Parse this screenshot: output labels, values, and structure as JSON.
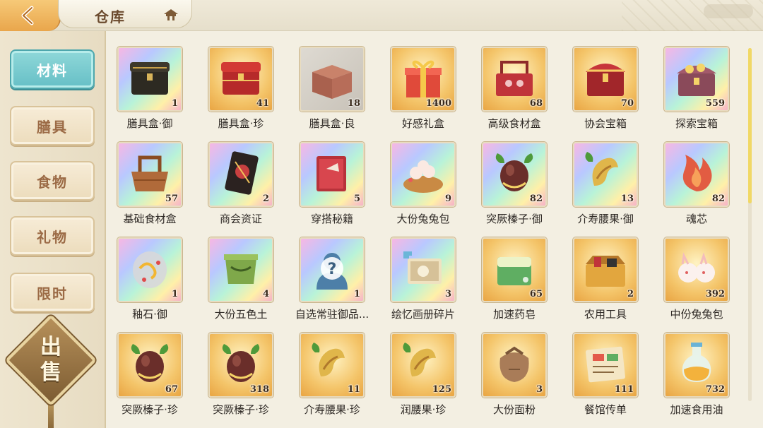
{
  "header": {
    "title": "仓库"
  },
  "sidebar": {
    "tabs": [
      {
        "label": "材料",
        "active": true
      },
      {
        "label": "膳具",
        "active": false
      },
      {
        "label": "食物",
        "active": false
      },
      {
        "label": "礼物",
        "active": false
      },
      {
        "label": "限时",
        "active": false
      }
    ],
    "sell_label": "出售"
  },
  "items": [
    {
      "name": "膳具盒·御",
      "count": "1",
      "bg": "rainbow",
      "icon": "black-chest-icon"
    },
    {
      "name": "膳具盒·珍",
      "count": "41",
      "bg": "gold",
      "icon": "red-chest-icon"
    },
    {
      "name": "膳具盒·良",
      "count": "18",
      "bg": "gray",
      "icon": "plain-box-icon"
    },
    {
      "name": "好感礼盒",
      "count": "1400",
      "bg": "gold",
      "icon": "gift-box-icon"
    },
    {
      "name": "高级食材盒",
      "count": "68",
      "bg": "gold",
      "icon": "food-basket-icon"
    },
    {
      "name": "协会宝箱",
      "count": "70",
      "bg": "gold",
      "icon": "treasure-chest-icon"
    },
    {
      "name": "探索宝箱",
      "count": "559",
      "bg": "rainbow",
      "icon": "explore-chest-icon"
    },
    {
      "name": "基础食材盒",
      "count": "57",
      "bg": "rainbow",
      "icon": "wooden-basket-icon"
    },
    {
      "name": "商会资证",
      "count": "2",
      "bg": "rainbow",
      "icon": "card-icon"
    },
    {
      "name": "穿搭秘籍",
      "count": "5",
      "bg": "rainbow",
      "icon": "book-icon"
    },
    {
      "name": "大份兔兔包",
      "count": "9",
      "bg": "rainbow",
      "icon": "bun-basket-icon"
    },
    {
      "name": "突厥榛子·御",
      "count": "82",
      "bg": "rainbow",
      "icon": "hazelnut-icon"
    },
    {
      "name": "介寿腰果·御",
      "count": "13",
      "bg": "rainbow",
      "icon": "cashew-icon"
    },
    {
      "name": "魂芯",
      "count": "82",
      "bg": "rainbow",
      "icon": "flame-icon"
    },
    {
      "name": "釉石·御",
      "count": "1",
      "bg": "rainbow",
      "icon": "glaze-stone-icon"
    },
    {
      "name": "大份五色土",
      "count": "4",
      "bg": "rainbow",
      "icon": "jade-vessel-icon"
    },
    {
      "name": "自选常驻御品...",
      "count": "1",
      "bg": "rainbow",
      "icon": "mystery-icon"
    },
    {
      "name": "绘忆画册碎片",
      "count": "3",
      "bg": "rainbow",
      "icon": "puzzle-album-icon"
    },
    {
      "name": "加速药皂",
      "count": "65",
      "bg": "gold",
      "icon": "soap-icon"
    },
    {
      "name": "农用工具",
      "count": "2",
      "bg": "gold",
      "icon": "toolbox-icon"
    },
    {
      "name": "中份兔兔包",
      "count": "392",
      "bg": "gold",
      "icon": "bunny-bun-icon"
    },
    {
      "name": "突厥榛子·珍",
      "count": "67",
      "bg": "gold",
      "icon": "hazelnut-icon"
    },
    {
      "name": "突厥榛子·珍",
      "count": "318",
      "bg": "gold",
      "icon": "hazelnut-icon"
    },
    {
      "name": "介寿腰果·珍",
      "count": "11",
      "bg": "gold",
      "icon": "cashew-icon"
    },
    {
      "name": "润腰果·珍",
      "count": "125",
      "bg": "gold",
      "icon": "cashew-icon"
    },
    {
      "name": "大份面粉",
      "count": "3",
      "bg": "gold",
      "icon": "sack-icon"
    },
    {
      "name": "餐馆传单",
      "count": "111",
      "bg": "gold",
      "icon": "menu-scroll-icon"
    },
    {
      "name": "加速食用油",
      "count": "732",
      "bg": "gold",
      "icon": "potion-icon"
    }
  ]
}
